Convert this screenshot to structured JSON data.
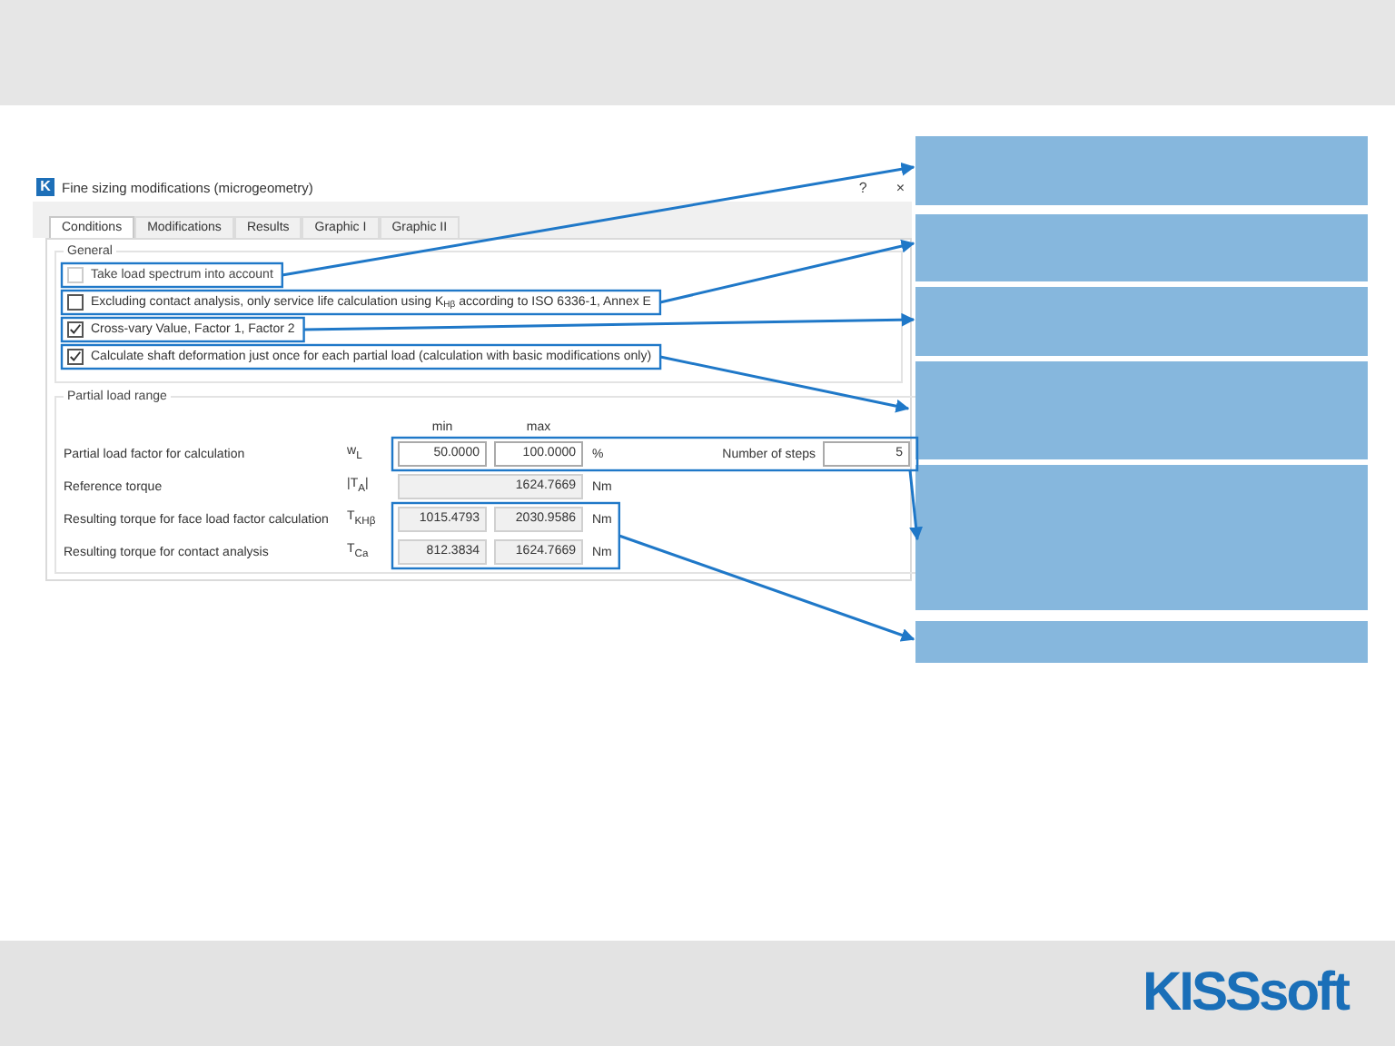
{
  "dialog": {
    "title": "Fine sizing modifications (microgeometry)",
    "app_icon": "K",
    "help": "?",
    "close": "×",
    "tabs": [
      {
        "label": "Conditions",
        "selected": true
      },
      {
        "label": "Modifications",
        "selected": false
      },
      {
        "label": "Results",
        "selected": false
      },
      {
        "label": "Graphic I",
        "selected": false
      },
      {
        "label": "Graphic II",
        "selected": false
      }
    ],
    "general": {
      "title": "General",
      "options": [
        {
          "label": "Take load spectrum into account",
          "checked": false,
          "disabled": true
        },
        {
          "label": "Excluding contact analysis, only service life calculation using K$_{Hβ}$ according to ISO 6336-1, Annex E",
          "checked": false,
          "disabled": false
        },
        {
          "label": "Cross-vary Value, Factor 1, Factor 2",
          "checked": true,
          "disabled": false
        },
        {
          "label": "Calculate shaft deformation just once for each partial load (calculation with basic modifications only)",
          "checked": true,
          "disabled": false
        }
      ]
    },
    "partial_load": {
      "title": "Partial load range",
      "col_min": "min",
      "col_max": "max",
      "steps_label": "Number of steps",
      "steps": "5",
      "rows": [
        {
          "kind": "input_range",
          "label": "Partial load factor for calculation",
          "symbol": "w$_{L}$",
          "min": "50.0000",
          "max": "100.0000",
          "unit": "%"
        },
        {
          "kind": "readonly_single",
          "label": "Reference torque",
          "symbol": "|T$_{A}$|",
          "value": "1624.7669",
          "unit": "Nm"
        },
        {
          "kind": "readonly_range",
          "label": "Resulting torque for face load factor calculation",
          "symbol": "T$_{KHβ}$",
          "min": "1015.4793",
          "max": "2030.9586",
          "unit": "Nm"
        },
        {
          "kind": "readonly_range",
          "label": "Resulting torque for contact analysis",
          "symbol": "T$_{Ca}$",
          "min": "812.3834",
          "max": "1624.7669",
          "unit": "Nm"
        }
      ]
    }
  },
  "logo": "KISSsoft"
}
